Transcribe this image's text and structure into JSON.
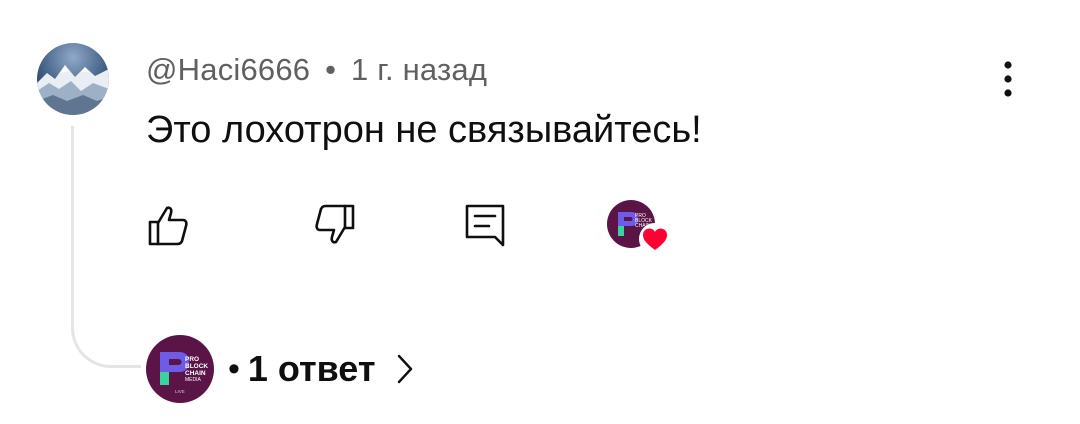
{
  "comment": {
    "author": "@Haci6666",
    "separator": "•",
    "time": "1 г. назад",
    "text": "Это лохотрон не связывайтесь!",
    "avatar_icon": "mountain-landscape-avatar"
  },
  "actions": {
    "like_icon": "thumbs-up-icon",
    "dislike_icon": "thumbs-down-icon",
    "reply_icon": "reply-icon",
    "creator_heart_icon": "heart-icon",
    "more_icon": "more-vert-icon"
  },
  "channel_logo": {
    "line1": "PRO",
    "line2": "BLOCK",
    "line3": "CHAIN",
    "line4": "MEDIA",
    "line5": "LIVE"
  },
  "replies": {
    "separator": "•",
    "label": "1 ответ"
  },
  "colors": {
    "text_primary": "#0f0f0f",
    "text_secondary": "#606060",
    "thread_line": "#e5e5e5",
    "heart_red": "#ff0033",
    "logo_bg": "#5a1446"
  }
}
